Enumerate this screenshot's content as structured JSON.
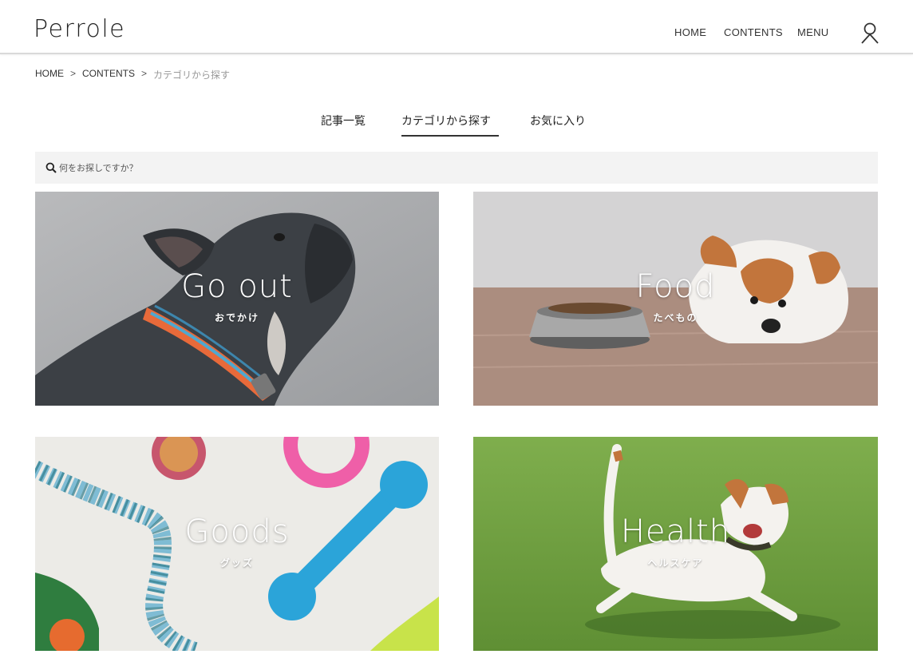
{
  "app": {
    "logo": "Perrole"
  },
  "header": {
    "nav": [
      {
        "label": "HOME"
      },
      {
        "label": "CONTENTS"
      },
      {
        "label": "MENU"
      }
    ],
    "user_icon": "user-icon"
  },
  "breadcrumb": {
    "items": [
      "HOME",
      "CONTENTS",
      "カテゴリから探す"
    ],
    "separator": ">"
  },
  "tabs": {
    "items": [
      {
        "label": "記事一覧"
      },
      {
        "label": "カテゴリから探す",
        "active": true
      },
      {
        "label": "お気に入り"
      }
    ]
  },
  "search": {
    "placeholder": "何をお探しですか？",
    "icon": "search-icon"
  },
  "categories": [
    {
      "title": "Go out",
      "subtitle": "おでかけ"
    },
    {
      "title": "Food",
      "subtitle": "たべもの"
    },
    {
      "title": "Goods",
      "subtitle": "グッズ"
    },
    {
      "title": "Health",
      "subtitle": "ヘルスケア"
    }
  ],
  "colors": {
    "text": "#333333",
    "header_border": "#d9d9d9",
    "search_bg": "#f3f3f3",
    "active_tab_underline": "#333333"
  }
}
